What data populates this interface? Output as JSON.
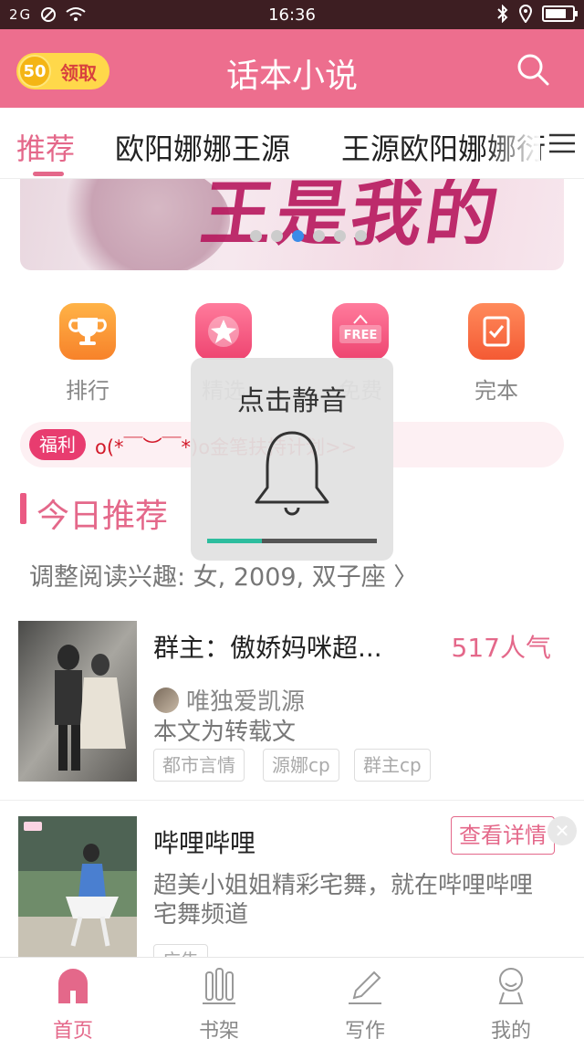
{
  "status_bar": {
    "signal": "2G",
    "time": "16:36",
    "battery_level": 0.8
  },
  "header": {
    "coin_count": "50",
    "coin_label": "领取",
    "title": "话本小说",
    "search_icon": "search-icon"
  },
  "tabs": [
    {
      "label": "推荐",
      "active": true
    },
    {
      "label": "欧阳娜娜王源",
      "active": false
    },
    {
      "label": "王源欧阳娜娜衍",
      "active": false
    }
  ],
  "banner": {
    "title": "王是我的",
    "slide_count": 6,
    "active_slide": 3
  },
  "quick_entries": [
    {
      "label": "排行",
      "icon": "trophy-icon",
      "color": "#f7932a"
    },
    {
      "label": "精选",
      "icon": "star-icon",
      "color": "#f2557e"
    },
    {
      "label": "免费",
      "icon": "free-icon",
      "color": "#f2557e",
      "badge_text": "FREE"
    },
    {
      "label": "完本",
      "icon": "check-book-icon",
      "color": "#f6623f"
    }
  ],
  "welfare": {
    "badge": "福利",
    "text": "o(*￣︶￣*)o金笔扶持计划>>"
  },
  "recommend": {
    "title": "今日推荐",
    "interest": "调整阅读兴趣: 女, 2009, 双子座 〉"
  },
  "books": [
    {
      "title": "群主：傲娇妈咪超...",
      "popularity": "517人气",
      "author": "唯独爱凯源",
      "desc": "本文为转载文",
      "tags": [
        "都市言情",
        "源娜cp",
        "群主cp"
      ]
    }
  ],
  "ad": {
    "title": "哔哩哔哩",
    "button": "查看详情",
    "desc_line1": "超美小姐姐精彩宅舞，就在哔哩哔哩",
    "desc_line2": "宅舞频道",
    "tag": "广告"
  },
  "mute_toast": {
    "title": "点击静音",
    "volume_level": 0.32
  },
  "bottom_nav": [
    {
      "label": "首页",
      "icon": "home-icon",
      "active": true
    },
    {
      "label": "书架",
      "icon": "bookshelf-icon",
      "active": false
    },
    {
      "label": "写作",
      "icon": "pen-icon",
      "active": false
    },
    {
      "label": "我的",
      "icon": "profile-icon",
      "active": false
    }
  ],
  "colors": {
    "brand": "#ed6e8e",
    "accent": "#e4688a",
    "status_bar": "#3d1e22"
  }
}
